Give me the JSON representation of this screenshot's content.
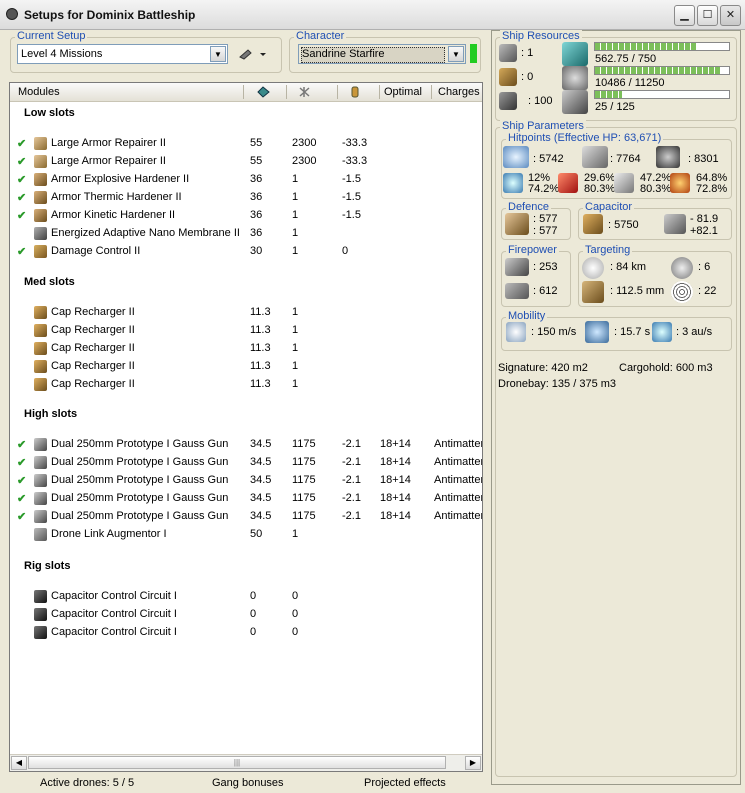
{
  "window": {
    "title": "Setups for Dominix Battleship"
  },
  "setup": {
    "legend": "Current Setup",
    "value": "Level 4 Missions"
  },
  "character": {
    "legend": "Character",
    "value": "Sandrine Starfire"
  },
  "columns": {
    "modules": "Modules",
    "optimal": "Optimal",
    "charges": "Charges"
  },
  "sections": [
    {
      "title": "Low slots",
      "rows": [
        {
          "checked": true,
          "name": "Large Armor Repairer II",
          "v1": "55",
          "v2": "2300",
          "v3": "-33.3",
          "opt": "",
          "charge": "",
          "icon": "armor-repairer-icon"
        },
        {
          "checked": true,
          "name": "Large Armor Repairer II",
          "v1": "55",
          "v2": "2300",
          "v3": "-33.3",
          "opt": "",
          "charge": "",
          "icon": "armor-repairer-icon"
        },
        {
          "checked": true,
          "name": "Armor Explosive Hardener II",
          "v1": "36",
          "v2": "1",
          "v3": "-1.5",
          "opt": "",
          "charge": "",
          "icon": "hardener-icon"
        },
        {
          "checked": true,
          "name": "Armor Thermic Hardener II",
          "v1": "36",
          "v2": "1",
          "v3": "-1.5",
          "opt": "",
          "charge": "",
          "icon": "hardener-icon"
        },
        {
          "checked": true,
          "name": "Armor Kinetic Hardener II",
          "v1": "36",
          "v2": "1",
          "v3": "-1.5",
          "opt": "",
          "charge": "",
          "icon": "hardener-icon"
        },
        {
          "checked": false,
          "name": "Energized Adaptive Nano Membrane II",
          "v1": "36",
          "v2": "1",
          "v3": "",
          "opt": "",
          "charge": "",
          "icon": "membrane-icon"
        },
        {
          "checked": true,
          "name": "Damage Control II",
          "v1": "30",
          "v2": "1",
          "v3": "0",
          "opt": "",
          "charge": "",
          "icon": "damage-control-icon"
        }
      ]
    },
    {
      "title": "Med slots",
      "rows": [
        {
          "checked": false,
          "name": "Cap Recharger II",
          "v1": "11.3",
          "v2": "1",
          "v3": "",
          "opt": "",
          "charge": "",
          "icon": "cap-recharger-icon"
        },
        {
          "checked": false,
          "name": "Cap Recharger II",
          "v1": "11.3",
          "v2": "1",
          "v3": "",
          "opt": "",
          "charge": "",
          "icon": "cap-recharger-icon"
        },
        {
          "checked": false,
          "name": "Cap Recharger II",
          "v1": "11.3",
          "v2": "1",
          "v3": "",
          "opt": "",
          "charge": "",
          "icon": "cap-recharger-icon"
        },
        {
          "checked": false,
          "name": "Cap Recharger II",
          "v1": "11.3",
          "v2": "1",
          "v3": "",
          "opt": "",
          "charge": "",
          "icon": "cap-recharger-icon"
        },
        {
          "checked": false,
          "name": "Cap Recharger II",
          "v1": "11.3",
          "v2": "1",
          "v3": "",
          "opt": "",
          "charge": "",
          "icon": "cap-recharger-icon"
        }
      ]
    },
    {
      "title": "High slots",
      "rows": [
        {
          "checked": true,
          "name": "Dual 250mm Prototype I Gauss Gun",
          "v1": "34.5",
          "v2": "1175",
          "v3": "-2.1",
          "opt": "18+14",
          "charge": "Antimatter",
          "icon": "gauss-gun-icon"
        },
        {
          "checked": true,
          "name": "Dual 250mm Prototype I Gauss Gun",
          "v1": "34.5",
          "v2": "1175",
          "v3": "-2.1",
          "opt": "18+14",
          "charge": "Antimatter",
          "icon": "gauss-gun-icon"
        },
        {
          "checked": true,
          "name": "Dual 250mm Prototype I Gauss Gun",
          "v1": "34.5",
          "v2": "1175",
          "v3": "-2.1",
          "opt": "18+14",
          "charge": "Antimatter",
          "icon": "gauss-gun-icon"
        },
        {
          "checked": true,
          "name": "Dual 250mm Prototype I Gauss Gun",
          "v1": "34.5",
          "v2": "1175",
          "v3": "-2.1",
          "opt": "18+14",
          "charge": "Antimatter",
          "icon": "gauss-gun-icon"
        },
        {
          "checked": true,
          "name": "Dual 250mm Prototype I Gauss Gun",
          "v1": "34.5",
          "v2": "1175",
          "v3": "-2.1",
          "opt": "18+14",
          "charge": "Antimatter",
          "icon": "gauss-gun-icon"
        },
        {
          "checked": false,
          "name": "Drone Link Augmentor I",
          "v1": "50",
          "v2": "1",
          "v3": "",
          "opt": "",
          "charge": "",
          "icon": "drone-link-icon"
        }
      ]
    },
    {
      "title": "Rig slots",
      "rows": [
        {
          "checked": false,
          "name": "Capacitor Control Circuit I",
          "v1": "0",
          "v2": "0",
          "v3": "",
          "opt": "",
          "charge": "",
          "icon": "rig-icon"
        },
        {
          "checked": false,
          "name": "Capacitor Control Circuit I",
          "v1": "0",
          "v2": "0",
          "v3": "",
          "opt": "",
          "charge": "",
          "icon": "rig-icon"
        },
        {
          "checked": false,
          "name": "Capacitor Control Circuit I",
          "v1": "0",
          "v2": "0",
          "v3": "",
          "opt": "",
          "charge": "",
          "icon": "rig-icon"
        }
      ]
    }
  ],
  "status": {
    "drones": "Active drones: 5 / 5",
    "gang": "Gang bonuses",
    "projected": "Projected effects"
  },
  "resources": {
    "legend": "Ship Resources",
    "turret_slots": ": 1",
    "launcher_slots": ": 0",
    "calibration": ": 100",
    "cpu": {
      "text": "562.75 / 750",
      "fraction": 0.75
    },
    "powergrid": {
      "text": "10486 / 11250",
      "fraction": 0.93
    },
    "drone_bandwidth": {
      "text": "25 / 125",
      "fraction": 0.2
    }
  },
  "params": {
    "legend": "Ship Parameters",
    "hitpoints": {
      "legend": "Hitpoints (Effective HP: 63,671)",
      "shield": ": 5742",
      "armor": ": 7764",
      "structure": ": 8301",
      "em": [
        "12%",
        "74.2%"
      ],
      "thermal": [
        "29.6%",
        "80.3%"
      ],
      "kinetic": [
        "47.2%",
        "80.3%"
      ],
      "explosive": [
        "64.8%",
        "72.8%"
      ]
    },
    "defence": {
      "legend": "Defence",
      "v1": ": 577",
      "v2": ": 577"
    },
    "capacitor": {
      "legend": "Capacitor",
      "amount": ": 5750",
      "rate1": "- 81.9",
      "rate2": "+82.1"
    },
    "firepower": {
      "legend": "Firepower",
      "turret": ": 253",
      "drone": ": 612"
    },
    "targeting": {
      "legend": "Targeting",
      "range": ": 84 km",
      "targets": ": 6",
      "resolution": ": 112.5 mm",
      "sensor": ": 22"
    },
    "mobility": {
      "legend": "Mobility",
      "velocity": ": 150 m/s",
      "align": ": 15.7 s",
      "warp": ": 3 au/s"
    },
    "signature": "Signature: 420 m2",
    "cargohold": "Cargohold: 600 m3",
    "dronebay": "Dronebay: 135 / 375 m3"
  }
}
